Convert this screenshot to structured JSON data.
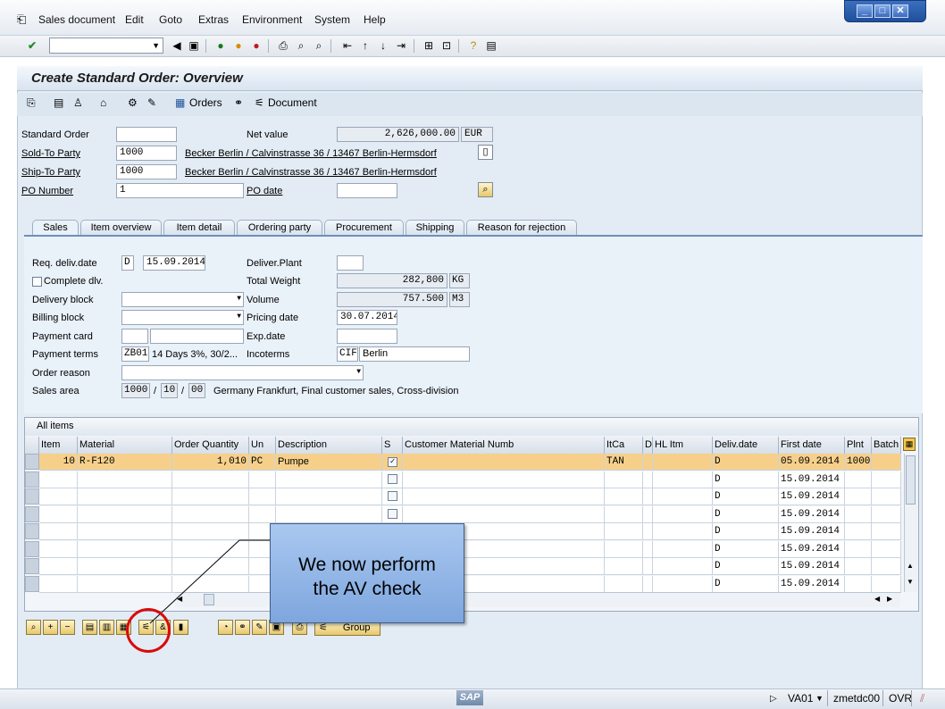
{
  "menu": {
    "items": [
      "Sales document",
      "Edit",
      "Goto",
      "Extras",
      "Environment",
      "System",
      "Help"
    ]
  },
  "window_controls": [
    "minimize",
    "maximize",
    "close"
  ],
  "title": "Create Standard Order: Overview",
  "app_toolbar": {
    "orders_label": "Orders",
    "document_label": "Document"
  },
  "header": {
    "standard_order_label": "Standard Order",
    "standard_order_value": "",
    "net_value_label": "Net value",
    "net_value": "2,626,000.00",
    "currency": "EUR",
    "sold_to_label": "Sold-To Party",
    "sold_to_value": "1000",
    "sold_to_address": "Becker Berlin / Calvinstrasse 36 / 13467 Berlin-Hermsdorf",
    "ship_to_label": "Ship-To Party",
    "ship_to_value": "1000",
    "ship_to_address": "Becker Berlin / Calvinstrasse 36 / 13467 Berlin-Hermsdorf",
    "po_number_label": "PO Number",
    "po_number_value": "1",
    "po_date_label": "PO date",
    "po_date_value": ""
  },
  "tabs": [
    "Sales",
    "Item overview",
    "Item detail",
    "Ordering party",
    "Procurement",
    "Shipping",
    "Reason for rejection"
  ],
  "sales_tab": {
    "req_deliv_label": "Req. deliv.date",
    "req_deliv_type": "D",
    "req_deliv_date": "15.09.2014",
    "deliver_plant_label": "Deliver.Plant",
    "deliver_plant_value": "",
    "complete_dlv_label": "Complete dlv.",
    "total_weight_label": "Total Weight",
    "total_weight_value": "282,800",
    "total_weight_unit": "KG",
    "delivery_block_label": "Delivery block",
    "volume_label": "Volume",
    "volume_value": "757.500",
    "volume_unit": "M3",
    "billing_block_label": "Billing block",
    "pricing_date_label": "Pricing date",
    "pricing_date_value": "30.07.2014",
    "payment_card_label": "Payment card",
    "exp_date_label": "Exp.date",
    "payment_terms_label": "Payment terms",
    "payment_terms_code": "ZB01",
    "payment_terms_text": "14 Days 3%, 30/2...",
    "incoterms_label": "Incoterms",
    "incoterms_code": "CIF",
    "incoterms_place": "Berlin",
    "order_reason_label": "Order reason",
    "sales_area_label": "Sales area",
    "sales_org": "1000",
    "dist_channel": "10",
    "division": "00",
    "sales_area_text": "Germany Frankfurt, Final customer sales, Cross-division"
  },
  "items_table": {
    "title": "All items",
    "columns": [
      "Item",
      "Material",
      "Order Quantity",
      "Un",
      "Description",
      "S",
      "Customer Material Numb",
      "ItCa",
      "D",
      "HL Itm",
      "Deliv.date",
      "First date",
      "Plnt",
      "Batch"
    ],
    "rows": [
      {
        "item": "10",
        "material": "R-F120",
        "qty": "1,010",
        "un": "PC",
        "desc": "Pumpe",
        "checked": true,
        "itca": "TAN",
        "deliv": "D",
        "first": "05.09.2014",
        "plnt": "1000"
      },
      {
        "item": "",
        "material": "",
        "qty": "",
        "un": "",
        "desc": "",
        "checked": false,
        "itca": "",
        "deliv": "D",
        "first": "15.09.2014",
        "plnt": ""
      },
      {
        "item": "",
        "material": "",
        "qty": "",
        "un": "",
        "desc": "",
        "checked": false,
        "itca": "",
        "deliv": "D",
        "first": "15.09.2014",
        "plnt": ""
      },
      {
        "item": "",
        "material": "",
        "qty": "",
        "un": "",
        "desc": "",
        "checked": false,
        "itca": "",
        "deliv": "D",
        "first": "15.09.2014",
        "plnt": ""
      },
      {
        "item": "",
        "material": "",
        "qty": "",
        "un": "",
        "desc": "",
        "checked": false,
        "itca": "",
        "deliv": "D",
        "first": "15.09.2014",
        "plnt": ""
      },
      {
        "item": "",
        "material": "",
        "qty": "",
        "un": "",
        "desc": "",
        "checked": false,
        "itca": "",
        "deliv": "D",
        "first": "15.09.2014",
        "plnt": ""
      },
      {
        "item": "",
        "material": "",
        "qty": "",
        "un": "",
        "desc": "",
        "checked": false,
        "itca": "",
        "deliv": "D",
        "first": "15.09.2014",
        "plnt": ""
      },
      {
        "item": "",
        "material": "",
        "qty": "",
        "un": "",
        "desc": "",
        "checked": false,
        "itca": "",
        "deliv": "D",
        "first": "15.09.2014",
        "plnt": ""
      }
    ]
  },
  "bottom_toolbar": {
    "group_label": "Group"
  },
  "callout": {
    "line1": "We now perform",
    "line2": "the AV check"
  },
  "statusbar": {
    "sap_logo": "SAP",
    "transaction": "VA01",
    "server": "zmetdc00",
    "mode": "OVR"
  },
  "colors": {
    "highlight_row": "#f6d08b",
    "callout_bg": "#8fb3e6",
    "circle": "#d90b0b"
  }
}
